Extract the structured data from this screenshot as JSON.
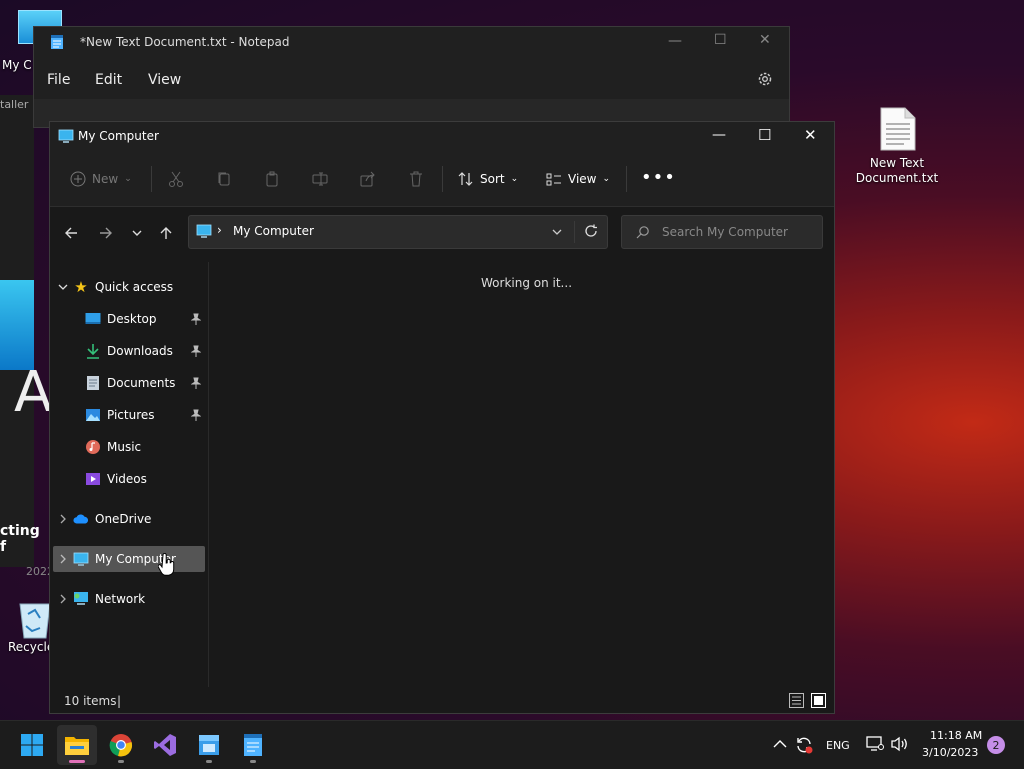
{
  "desktop": {
    "icons": [
      {
        "label": "My C"
      },
      {
        "label": "New Text Document.txt"
      },
      {
        "label": "Recycle"
      }
    ],
    "bg_window": {
      "fragment_top": "taller",
      "fragment_bottom": "cting f",
      "fragment_year": "2022"
    }
  },
  "notepad": {
    "title": "*New Text Document.txt - Notepad",
    "menu": [
      "File",
      "Edit",
      "View"
    ]
  },
  "explorer": {
    "title": "My Computer",
    "toolbar": {
      "new": "New",
      "sort": "Sort",
      "view": "View"
    },
    "address": "My Computer",
    "search_placeholder": "Search My Computer",
    "sidebar": {
      "quick_access": "Quick access",
      "items": [
        {
          "label": "Desktop",
          "pinned": true
        },
        {
          "label": "Downloads",
          "pinned": true
        },
        {
          "label": "Documents",
          "pinned": true
        },
        {
          "label": "Pictures",
          "pinned": true
        },
        {
          "label": "Music",
          "pinned": false
        },
        {
          "label": "Videos",
          "pinned": false
        }
      ],
      "onedrive": "OneDrive",
      "my_computer": "My Computer",
      "network": "Network"
    },
    "content_message": "Working on it...",
    "status": "10 items"
  },
  "taskbar": {
    "lang": "ENG",
    "time": "11:18 AM",
    "date": "3/10/2023",
    "notification_count": "2"
  },
  "colors": {
    "accent": "#0078d4",
    "selection": "#555555"
  }
}
